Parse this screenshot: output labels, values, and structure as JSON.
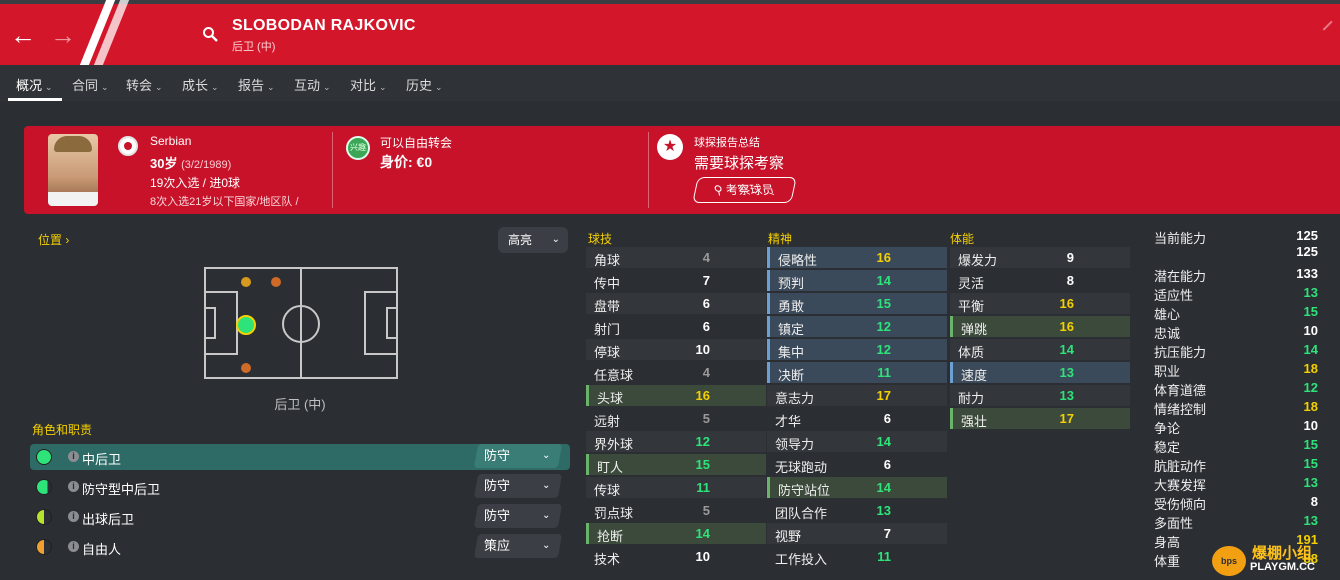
{
  "header": {
    "back_icon": "arrow-left-icon",
    "forward_icon": "arrow-right-icon",
    "name": "SLOBODAN RAJKOVIC",
    "position": "后卫 (中)",
    "brand_color": "#d4162a"
  },
  "tabs": [
    {
      "label": "概况",
      "active": true
    },
    {
      "label": "合同"
    },
    {
      "label": "转会"
    },
    {
      "label": "成长"
    },
    {
      "label": "报告"
    },
    {
      "label": "互动"
    },
    {
      "label": "对比"
    },
    {
      "label": "历史"
    }
  ],
  "profile": {
    "nationality": "Serbian",
    "age": "30岁",
    "dob": "(3/2/1989)",
    "caps": "19次入选 / 进0球",
    "u21": "8次入选21岁以下国家/地区队 /",
    "interest_badge": "兴趣",
    "transfer_status": "可以自由转会",
    "value": "身价: €0",
    "scout_title": "球探报告总结",
    "scout_need": "需要球探考察",
    "scout_button": "考察球员"
  },
  "position_panel": {
    "title": "位置",
    "highlight": "高亮",
    "caption": "后卫 (中)"
  },
  "roles": {
    "title": "角色和职责",
    "items": [
      {
        "name": "中后卫",
        "duty": "防守",
        "selected": true,
        "rating_color": "#2ee37a",
        "suitability": 1.0
      },
      {
        "name": "防守型中后卫",
        "duty": "防守",
        "selected": false,
        "rating_color": "#2ee37a",
        "suitability": 0.75
      },
      {
        "name": "出球后卫",
        "duty": "防守",
        "selected": false,
        "rating_color": "#b6e32e",
        "suitability": 0.5
      },
      {
        "name": "自由人",
        "duty": "策应",
        "selected": false,
        "rating_color": "#f0a030",
        "suitability": 0.5
      }
    ]
  },
  "attributes": {
    "technical_title": "球技",
    "mental_title": "精神",
    "physical_title": "体能",
    "technical": [
      {
        "name": "角球",
        "value": "4"
      },
      {
        "name": "传中",
        "value": "7"
      },
      {
        "name": "盘带",
        "value": "6"
      },
      {
        "name": "射门",
        "value": "6"
      },
      {
        "name": "停球",
        "value": "10"
      },
      {
        "name": "任意球",
        "value": "4"
      },
      {
        "name": "头球",
        "value": "16"
      },
      {
        "name": "远射",
        "value": "5"
      },
      {
        "name": "界外球",
        "value": "12"
      },
      {
        "name": "盯人",
        "value": "15"
      },
      {
        "name": "传球",
        "value": "11"
      },
      {
        "name": "罚点球",
        "value": "5"
      },
      {
        "name": "抢断",
        "value": "14"
      },
      {
        "name": "技术",
        "value": "10"
      }
    ],
    "mental": [
      {
        "name": "侵略性",
        "value": "16"
      },
      {
        "name": "预判",
        "value": "14"
      },
      {
        "name": "勇敢",
        "value": "15"
      },
      {
        "name": "镇定",
        "value": "12"
      },
      {
        "name": "集中",
        "value": "12"
      },
      {
        "name": "决断",
        "value": "11"
      },
      {
        "name": "意志力",
        "value": "17"
      },
      {
        "name": "才华",
        "value": "6"
      },
      {
        "name": "领导力",
        "value": "14"
      },
      {
        "name": "无球跑动",
        "value": "6"
      },
      {
        "name": "防守站位",
        "value": "14"
      },
      {
        "name": "团队合作",
        "value": "13"
      },
      {
        "name": "视野",
        "value": "7"
      },
      {
        "name": "工作投入",
        "value": "11"
      }
    ],
    "physical": [
      {
        "name": "爆发力",
        "value": "9"
      },
      {
        "name": "灵活",
        "value": "8"
      },
      {
        "name": "平衡",
        "value": "16"
      },
      {
        "name": "弹跳",
        "value": "16"
      },
      {
        "name": "体质",
        "value": "14"
      },
      {
        "name": "速度",
        "value": "13"
      },
      {
        "name": "耐力",
        "value": "13"
      },
      {
        "name": "强壮",
        "value": "17"
      }
    ]
  },
  "abilities": [
    {
      "name": "当前能力",
      "value": "125"
    },
    {
      "name": "",
      "value": "125"
    },
    {
      "name": "潜在能力",
      "value": "133"
    },
    {
      "name": "适应性",
      "value": "13"
    },
    {
      "name": "雄心",
      "value": "15"
    },
    {
      "name": "忠诚",
      "value": "10"
    },
    {
      "name": "抗压能力",
      "value": "14"
    },
    {
      "name": "职业",
      "value": "18"
    },
    {
      "name": "体育道德",
      "value": "12"
    },
    {
      "name": "情绪控制",
      "value": "18"
    },
    {
      "name": "争论",
      "value": "10"
    },
    {
      "name": "稳定",
      "value": "15"
    },
    {
      "name": "肮脏动作",
      "value": "15"
    },
    {
      "name": "大赛发挥",
      "value": "13"
    },
    {
      "name": "受伤倾向",
      "value": "8"
    },
    {
      "name": "多面性",
      "value": "13"
    },
    {
      "name": "身高",
      "value": "191"
    },
    {
      "name": "体重",
      "value": "88"
    }
  ],
  "watermark": {
    "cn": "爆棚小组",
    "en": "PLAYGM.CC",
    "logo": "bps"
  },
  "colors": {
    "white": "#ffffff",
    "green": "#2ee37a",
    "yellow": "#f5d000",
    "grey": "#9a9a9a"
  }
}
